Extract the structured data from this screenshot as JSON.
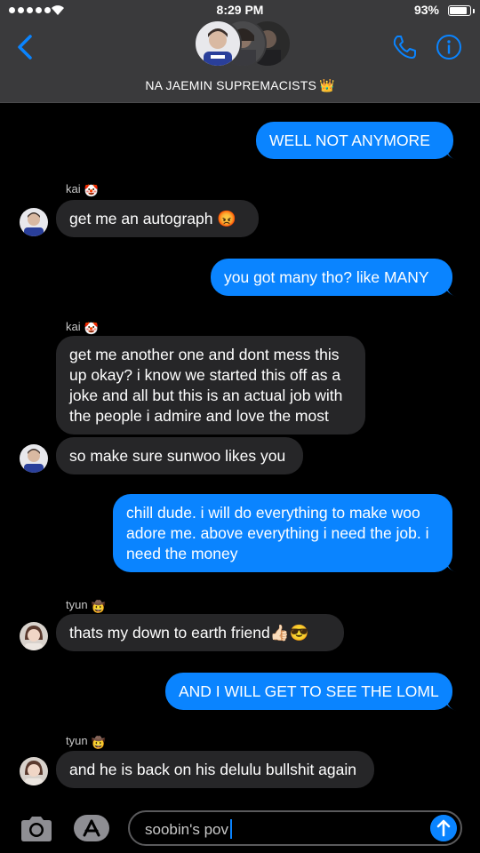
{
  "status_bar": {
    "time": "8:29 PM",
    "battery": "93%"
  },
  "header": {
    "group_name": "NA JAEMIN SUPREMACISTS",
    "crown_emoji": "👑",
    "icons": [
      "back-chevron-icon",
      "phone-icon",
      "info-icon"
    ]
  },
  "messages": [
    {
      "side": "out",
      "text": "WELL NOT ANYMORE"
    },
    {
      "side": "in",
      "sender": "kai",
      "sender_emoji": "🤡",
      "text": "get me an autograph",
      "emoji": "😡"
    },
    {
      "side": "out",
      "text": "you got many tho? like MANY"
    },
    {
      "side": "in",
      "sender": "kai",
      "sender_emoji": "🤡",
      "text": "get me another one and dont mess this up okay? i know we started this off as a joke and all but this is an actual job with the people i admire and love the most"
    },
    {
      "side": "in",
      "text": "so make sure sunwoo likes you"
    },
    {
      "side": "out",
      "text": "chill dude. i will do everything to make woo adore me. above everything i need the job. i need the money"
    },
    {
      "side": "in",
      "sender": "tyun",
      "sender_emoji": "🤠",
      "text": "thats my down to earth friend",
      "emoji": "👍🏻😎"
    },
    {
      "side": "out",
      "text": "AND I WILL GET TO SEE THE LOML"
    },
    {
      "side": "in",
      "sender": "tyun",
      "sender_emoji": "🤠",
      "text": "and he is back on his delulu bullshit again"
    }
  ],
  "composer": {
    "input_value": "soobin's pov"
  },
  "colors": {
    "outgoing": "#0a84ff",
    "incoming": "#262628",
    "header": "#3a3a3c",
    "accent": "#0a84ff"
  }
}
